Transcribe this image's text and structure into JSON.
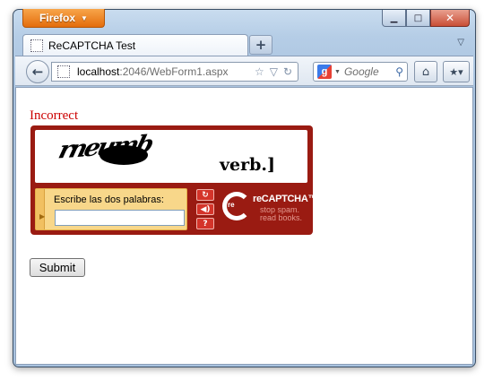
{
  "browser": {
    "menu_button_label": "Firefox",
    "tab_title": "ReCAPTCHA Test",
    "new_tab_label": "+",
    "url_host": "localhost",
    "url_path": ":2046/WebForm1.aspx",
    "search_placeholder": "Google"
  },
  "page": {
    "error_message": "Incorrect",
    "submit_label": "Submit"
  },
  "recaptcha": {
    "challenge_word_1": "rneumb",
    "challenge_word_2": "verb.]",
    "answer_label": "Escribe las dos palabras:",
    "answer_value": "",
    "logo_re": "re",
    "logo_name": "reCAPTCHA™",
    "tagline": "stop spam. read books.",
    "buttons": {
      "reload_icon": "reload-icon",
      "audio_icon": "audio-icon",
      "help_icon": "help-icon",
      "help_glyph": "?"
    },
    "colors": {
      "frame": "#9a1b12",
      "answer_panel": "#f8d78a",
      "button": "#d4342a"
    }
  },
  "colors": {
    "error_text": "#cc0000",
    "firefox_button": "#e46d0c"
  }
}
